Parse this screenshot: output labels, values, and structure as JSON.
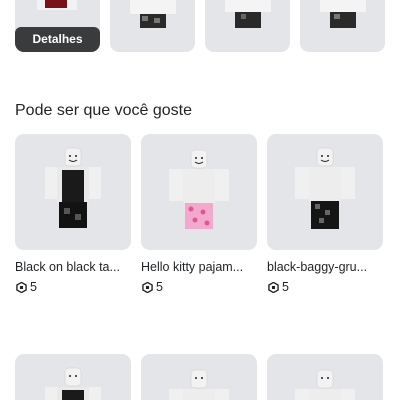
{
  "top_row": {
    "details_label": "Detalhes"
  },
  "recommendations": {
    "title": "Pode ser que você goste",
    "items": [
      {
        "name": "Black on black ta...",
        "price": "5",
        "pants": "black"
      },
      {
        "name": "Hello kitty pajam...",
        "price": "5",
        "pants": "pink"
      },
      {
        "name": "black-baggy-gru...",
        "price": "5",
        "pants": "black-baggy"
      }
    ]
  },
  "colors": {
    "tile_bg": "#e3e5e9",
    "details_bg": "#393b3d",
    "text": "#1f2226"
  }
}
